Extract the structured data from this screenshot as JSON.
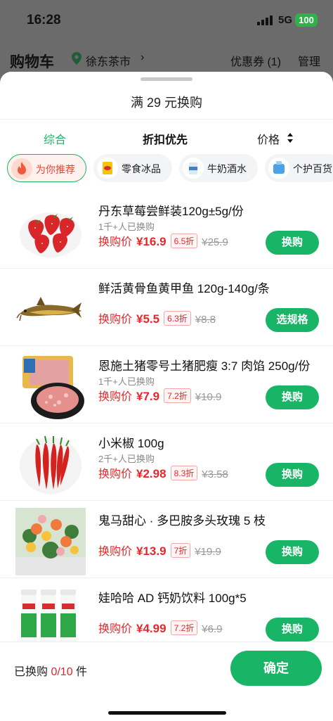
{
  "status": {
    "time": "16:28",
    "network": "5G",
    "battery": "100"
  },
  "header": {
    "title": "购物车",
    "location": "徐东茶市",
    "location_arrow": "›",
    "coupon": "优惠券 (1)",
    "manage": "管理"
  },
  "sheet": {
    "title": "满 29 元换购"
  },
  "sort_tabs": [
    {
      "label": "综合",
      "active": true
    },
    {
      "label": "折扣优先"
    },
    {
      "label": "价格"
    }
  ],
  "chips": [
    {
      "label": "为你推荐",
      "icon": "flame-icon",
      "selected": true
    },
    {
      "label": "零食冰品",
      "icon": "snack-bag-icon"
    },
    {
      "label": "牛奶酒水",
      "icon": "milk-carton-icon"
    },
    {
      "label": "个护百货",
      "icon": "toiletries-icon"
    }
  ],
  "price_prefix": "换购价",
  "products": [
    {
      "name": "丹东草莓尝鲜装120g±5g/份",
      "sold": "1千+人已换购",
      "price": "¥16.9",
      "discount": "6.5折",
      "original": "¥25.9",
      "action": "换购",
      "image": "strawberries-image"
    },
    {
      "name": "鲜活黄骨鱼黄甲鱼 120g-140g/条",
      "sold": "",
      "price": "¥5.5",
      "discount": "6.3折",
      "original": "¥8.8",
      "action": "选规格",
      "image": "yellow-catfish-image"
    },
    {
      "name": "恩施土猪零号土猪肥瘦 3:7 肉馅 250g/份",
      "sold": "1千+人已换购",
      "price": "¥7.9",
      "discount": "7.2折",
      "original": "¥10.9",
      "action": "换购",
      "image": "minced-pork-image"
    },
    {
      "name": "小米椒 100g",
      "sold": "2千+人已换购",
      "price": "¥2.98",
      "discount": "8.3折",
      "original": "¥3.58",
      "action": "换购",
      "image": "red-chili-image"
    },
    {
      "name": "鬼马甜心 · 多巴胺多头玫瑰 5 枝",
      "sold": "",
      "price": "¥13.9",
      "discount": "7折",
      "original": "¥19.9",
      "action": "换购",
      "image": "roses-bouquet-image"
    },
    {
      "name": "娃哈哈 AD 钙奶饮料 100g*5",
      "sold": "",
      "price": "¥4.99",
      "discount": "7.2折",
      "original": "¥6.9",
      "action": "换购",
      "image": "ad-milk-bottles-image"
    }
  ],
  "footer": {
    "label_prefix": "已换购 ",
    "count": "0/10",
    "label_suffix": " 件",
    "confirm": "确定"
  },
  "colors": {
    "accent_green": "#19b566",
    "price_red": "#e8262b"
  }
}
